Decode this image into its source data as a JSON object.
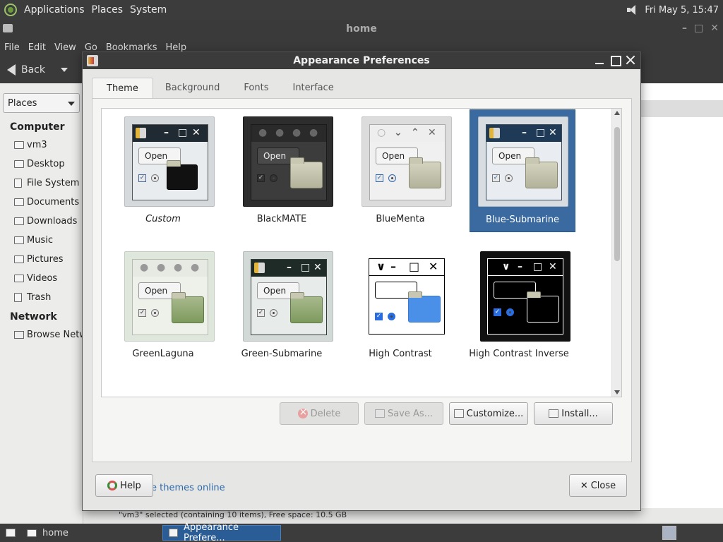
{
  "top_panel": {
    "menus": [
      "Applications",
      "Places",
      "System"
    ],
    "clock": "Fri May 5, 15:47"
  },
  "caja": {
    "title": "home",
    "menus": [
      "File",
      "Edit",
      "View",
      "Go",
      "Bookmarks",
      "Help"
    ],
    "back_label": "Back",
    "places_label": "Places",
    "computer_header": "Computer",
    "computer_items": [
      "vm3",
      "Desktop",
      "File System",
      "Documents",
      "Downloads",
      "Music",
      "Pictures",
      "Videos",
      "Trash"
    ],
    "network_header": "Network",
    "network_items": [
      "Browse Netw"
    ],
    "status": "\"vm3\" selected (containing 10 items), Free space: 10.5 GB"
  },
  "dialog": {
    "title": "Appearance Preferences",
    "tabs": [
      "Theme",
      "Background",
      "Fonts",
      "Interface"
    ],
    "active_tab": "Theme",
    "themes": [
      {
        "name": "Custom",
        "selected": false
      },
      {
        "name": "BlackMATE",
        "selected": false
      },
      {
        "name": "BlueMenta",
        "selected": false
      },
      {
        "name": "Blue-Submarine",
        "selected": true
      },
      {
        "name": "GreenLaguna",
        "selected": false
      },
      {
        "name": "Green-Submarine",
        "selected": false
      },
      {
        "name": "High Contrast",
        "selected": false
      },
      {
        "name": "High Contrast Inverse",
        "selected": false
      }
    ],
    "open_label": "Open",
    "buttons": {
      "delete": "Delete",
      "save_as": "Save As...",
      "customize": "Customize...",
      "install": "Install..."
    },
    "online_link": "Get more themes online",
    "help": "Help",
    "close": "Close"
  },
  "taskbar": {
    "tasks": [
      "home",
      "Appearance Prefere..."
    ]
  },
  "colors": {
    "selection": "#3a6aa0",
    "link": "#2e6aa8",
    "panel": "#3c3c3c"
  }
}
